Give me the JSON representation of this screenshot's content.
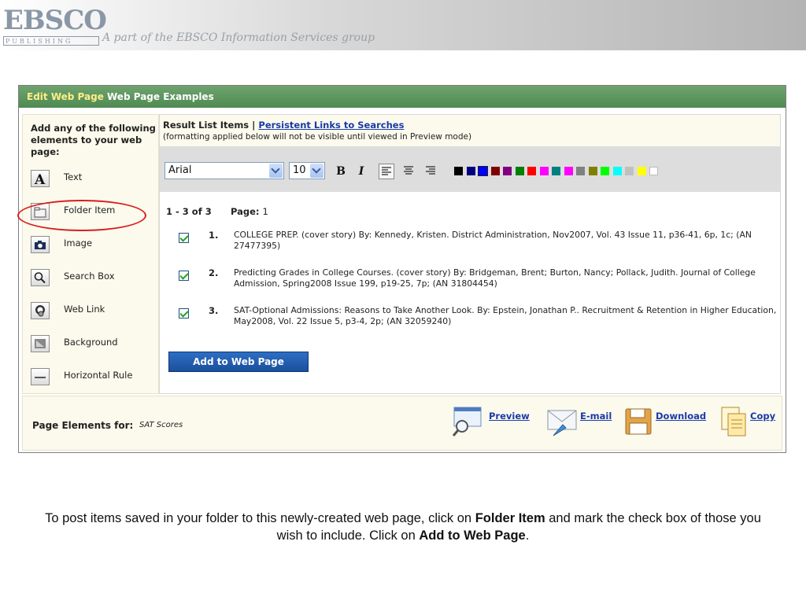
{
  "banner": {
    "logo_main": "EBSCO",
    "logo_sub": "PUBLISHING",
    "tagline": "A part of the EBSCO Information Services group"
  },
  "titlebar": {
    "edit_label": "Edit Web Page",
    "page_name": "Web Page Examples"
  },
  "sidebar": {
    "heading": "Add any of the following elements to your web page:",
    "tools": [
      {
        "label": "Text",
        "icon": "text-icon"
      },
      {
        "label": "Folder Item",
        "icon": "folder-icon"
      },
      {
        "label": "Image",
        "icon": "camera-icon"
      },
      {
        "label": "Search Box",
        "icon": "magnifier-icon"
      },
      {
        "label": "Web Link",
        "icon": "globe-link-icon"
      },
      {
        "label": "Background",
        "icon": "background-icon"
      },
      {
        "label": "Horizontal Rule",
        "icon": "horizontal-rule-icon"
      }
    ]
  },
  "main": {
    "header": {
      "title": "Result List Items",
      "separator": "|",
      "link": "Persistent Links to Searches",
      "note": "(formatting applied below will not be visible until viewed in Preview mode)"
    },
    "format": {
      "font": "Arial",
      "size": "10",
      "bold": "B",
      "italic": "I",
      "colors": [
        "#000000",
        "#000080",
        "#0000ff",
        "#800000",
        "#800080",
        "#008000",
        "#ff0000",
        "#ff00ff",
        "#008080",
        "#ff00ff",
        "#808080",
        "#808000",
        "#00ff00",
        "#00ffff",
        "#c0c0c0",
        "#ffff00",
        "#ffffff"
      ]
    },
    "results": {
      "range": "1 - 3 of 3",
      "page_label": "Page:",
      "page_number": "1",
      "items": [
        {
          "num": "1.",
          "checked": true,
          "citation": "COLLEGE PREP. (cover story) By: Kennedy, Kristen. District Administration, Nov2007, Vol. 43 Issue 11, p36-41, 6p, 1c; (AN 27477395)"
        },
        {
          "num": "2.",
          "checked": true,
          "citation": "Predicting Grades in College Courses. (cover story) By: Bridgeman, Brent; Burton, Nancy; Pollack, Judith. Journal of College Admission, Spring2008 Issue 199, p19-25, 7p; (AN 31804454)"
        },
        {
          "num": "3.",
          "checked": true,
          "citation": "SAT-Optional Admissions: Reasons to Take Another Look. By: Epstein, Jonathan P.. Recruitment & Retention in Higher Education, May2008, Vol. 22 Issue 5, p3-4, 2p; (AN 32059240)"
        }
      ],
      "add_button": "Add to Web Page"
    }
  },
  "footer": {
    "label": "Page Elements for:",
    "value": "SAT Scores",
    "actions": [
      "Preview",
      "E-mail",
      "Download",
      "Copy"
    ]
  },
  "caption": {
    "part1": "To post items saved in your folder to this newly-created web page, click on ",
    "bold1": "Folder Item",
    "part2": " and mark the check box of those you wish to include. Click on ",
    "bold2": "Add to Web Page",
    "part3": "."
  },
  "colors": {
    "titlebar": "#5a9a5e",
    "link": "#1a3aa8",
    "annotation": "#d91e1e",
    "button": "#1b4f9c"
  }
}
